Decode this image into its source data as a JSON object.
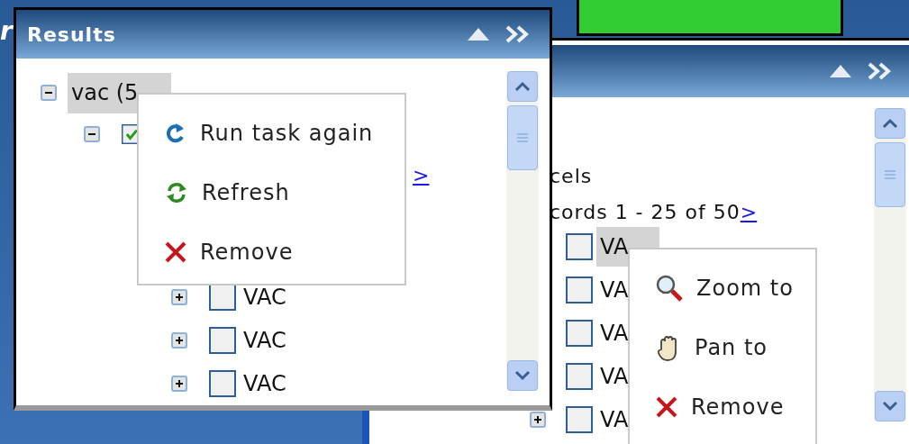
{
  "backdrop_text": "r",
  "results_panel": {
    "title": "Results",
    "tree": [
      {
        "label": "vac (5",
        "expanded": true,
        "highlighted": true,
        "children": [
          {
            "checked": true,
            "expanded": true,
            "page_link": ">",
            "children": [
              {
                "label": "VAC",
                "checked": false,
                "expanded": false
              },
              {
                "label": "VAC",
                "checked": false,
                "expanded": false
              },
              {
                "label": "VAC",
                "checked": false,
                "expanded": false
              }
            ]
          }
        ]
      }
    ]
  },
  "results_menu": {
    "items": [
      {
        "kind": "rerun",
        "label": "Run task again"
      },
      {
        "kind": "refresh",
        "label": "Refresh"
      },
      {
        "kind": "remove",
        "label": "Remove"
      }
    ]
  },
  "layer_panel": {
    "heading": "cels",
    "records": "cords 1 - 25 of 50",
    "page_link": ">",
    "rows": [
      {
        "label": "VA",
        "checked": false,
        "highlighted": true
      },
      {
        "label": "VA",
        "checked": false,
        "highlighted": false
      },
      {
        "label": "VA",
        "checked": false,
        "highlighted": false
      },
      {
        "label": "VA",
        "checked": false,
        "highlighted": false
      },
      {
        "label": "VA",
        "checked": false,
        "highlighted": false,
        "expanded": false
      }
    ]
  },
  "feature_menu": {
    "items": [
      {
        "kind": "zoom",
        "label": "Zoom to"
      },
      {
        "kind": "pan",
        "label": "Pan to"
      },
      {
        "kind": "remove",
        "label": "Remove"
      }
    ]
  }
}
